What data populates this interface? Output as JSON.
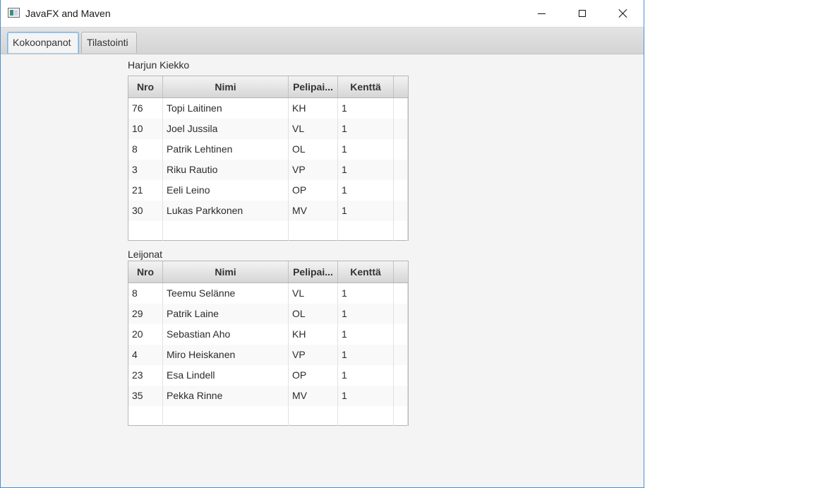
{
  "window": {
    "title": "JavaFX and Maven"
  },
  "tabs": [
    {
      "label": "Kokoonpanot",
      "active": true
    },
    {
      "label": "Tilastointi",
      "active": false
    }
  ],
  "columns": [
    "Nro",
    "Nimi",
    "Pelipai...",
    "Kenttä"
  ],
  "teams": [
    {
      "name": "Harjun Kiekko",
      "rows": [
        [
          "76",
          "Topi Laitinen",
          "KH",
          "1"
        ],
        [
          "10",
          "Joel Jussila",
          "VL",
          "1"
        ],
        [
          "8",
          "Patrik Lehtinen",
          "OL",
          "1"
        ],
        [
          "3",
          "Riku Rautio",
          "VP",
          "1"
        ],
        [
          "21",
          "Eeli Leino",
          "OP",
          "1"
        ],
        [
          "30",
          "Lukas Parkkonen",
          "MV",
          "1"
        ]
      ]
    },
    {
      "name": "Leijonat",
      "rows": [
        [
          "8",
          "Teemu Selänne",
          "VL",
          "1"
        ],
        [
          "29",
          "Patrik Laine",
          "OL",
          "1"
        ],
        [
          "20",
          "Sebastian Aho",
          "KH",
          "1"
        ],
        [
          "4",
          "Miro Heiskanen",
          "VP",
          "1"
        ],
        [
          "23",
          "Esa Lindell",
          "OP",
          "1"
        ],
        [
          "35",
          "Pekka Rinne",
          "MV",
          "1"
        ]
      ]
    }
  ]
}
